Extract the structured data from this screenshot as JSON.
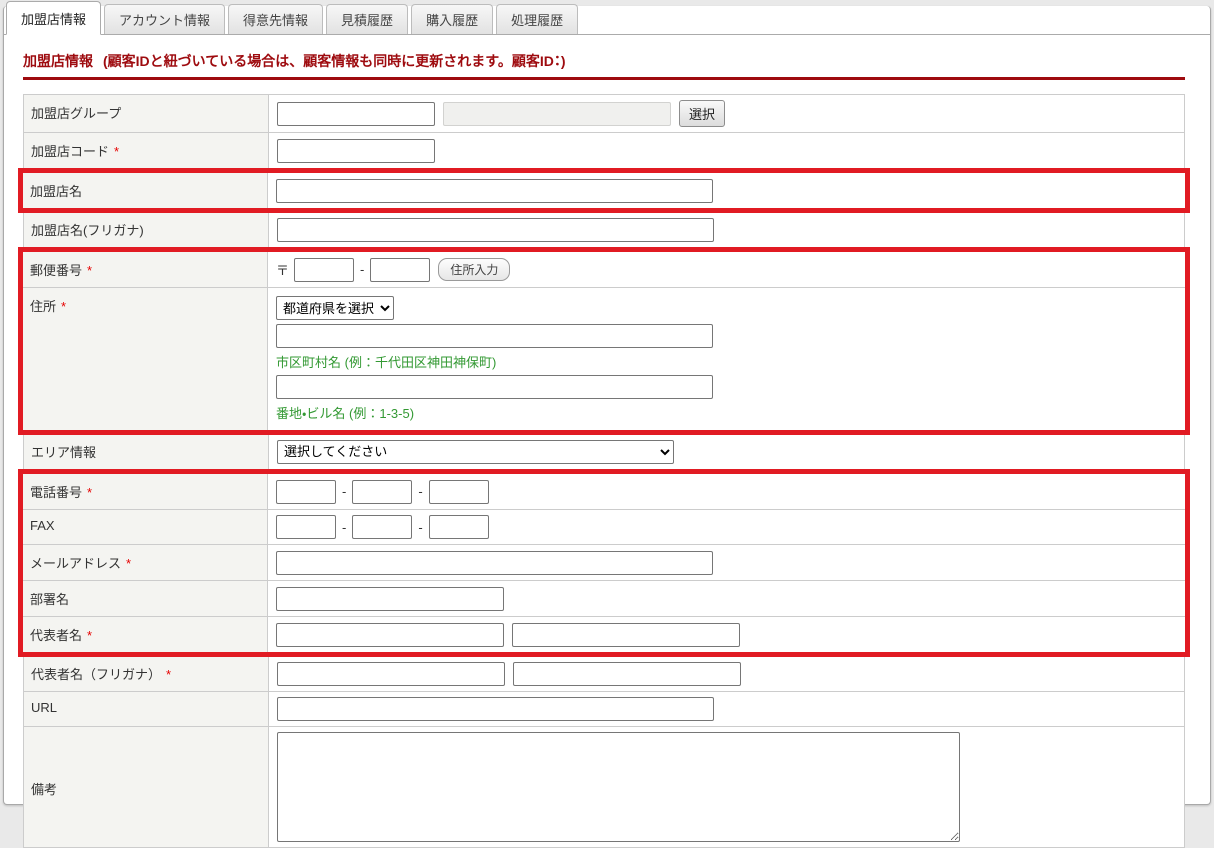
{
  "colors": {
    "highlight_red": "#e11b23",
    "title_red": "#9e0b0f",
    "hint_green": "#339933"
  },
  "required_marker": "*",
  "separators": {
    "dash": "-"
  },
  "tabs": {
    "items": [
      {
        "label": "加盟店情報"
      },
      {
        "label": "アカウント情報"
      },
      {
        "label": "得意先情報"
      },
      {
        "label": "見積履歴"
      },
      {
        "label": "購入履歴"
      },
      {
        "label": "処理履歴"
      }
    ]
  },
  "header": {
    "title": "加盟店情報",
    "note": "(顧客IDと紐づいている場合は、顧客情報も同時に更新されます。顧客ID：)"
  },
  "form": {
    "merchant_group": {
      "label": "加盟店グループ",
      "select_button": "選択",
      "name_value": "",
      "display_value": ""
    },
    "merchant_code": {
      "label": "加盟店コード",
      "value": ""
    },
    "merchant_name": {
      "label": "加盟店名",
      "value": ""
    },
    "merchant_name_kana": {
      "label": "加盟店名(フリガナ)",
      "value": ""
    },
    "postal_code": {
      "label": "郵便番号",
      "mark": "〒",
      "value1": "",
      "value2": "",
      "address_button": "住所入力"
    },
    "address": {
      "label": "住所",
      "prefecture_selected": "都道府県を選択",
      "city_value": "",
      "city_hint": "市区町村名 (例：千代田区神田神保町)",
      "street_value": "",
      "street_hint": "番地・ビル名 (例：1-3-5)"
    },
    "area": {
      "label": "エリア情報",
      "selected": "選択してください"
    },
    "phone": {
      "label": "電話番号",
      "value1": "",
      "value2": "",
      "value3": ""
    },
    "fax": {
      "label": "FAX",
      "value1": "",
      "value2": "",
      "value3": ""
    },
    "email": {
      "label": "メールアドレス",
      "value": ""
    },
    "department": {
      "label": "部署名",
      "value": ""
    },
    "representative": {
      "label": "代表者名",
      "value1": "",
      "value2": ""
    },
    "representative_kana": {
      "label": "代表者名（フリガナ）",
      "value1": "",
      "value2": ""
    },
    "url": {
      "label": "URL",
      "value": ""
    },
    "notes": {
      "label": "備考",
      "value": ""
    }
  }
}
